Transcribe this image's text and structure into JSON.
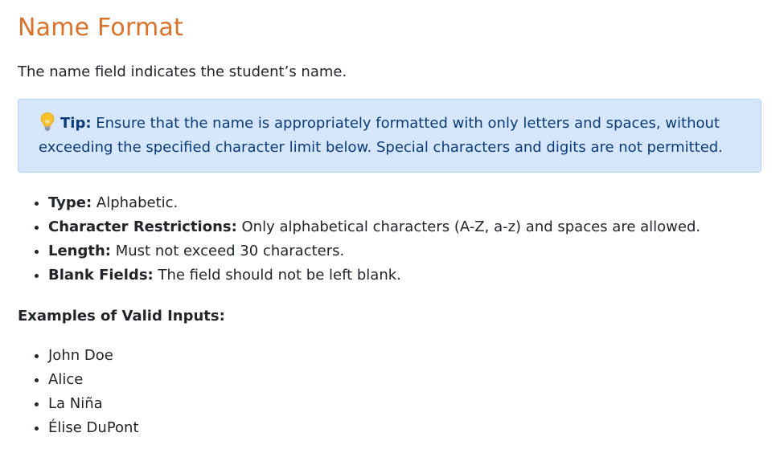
{
  "page": {
    "title": "Name Format",
    "intro": "The name field indicates the student’s name."
  },
  "tip": {
    "icon": "lightbulb-icon",
    "label": "Tip:",
    "text": " Ensure that the name is appropriately formatted with only letters and spaces, without exceeding the specified character limit below. Special characters and digits are not permitted."
  },
  "rules": [
    {
      "key": "Type:",
      "value": " Alphabetic."
    },
    {
      "key": "Character Restrictions:",
      "value": " Only alphabetical characters (A-Z, a-z) and spaces are allowed."
    },
    {
      "key": "Length:",
      "value": " Must not exceed 30 characters."
    },
    {
      "key": "Blank Fields:",
      "value": " The field should not be left blank."
    }
  ],
  "examples": {
    "heading": "Examples of Valid Inputs:",
    "items": [
      "John Doe",
      "Alice",
      "La Niña",
      "Élise DuPont"
    ]
  },
  "colors": {
    "title": "#d9732b",
    "tip_background": "#d6e7fd",
    "tip_text": "#0b3c7a"
  }
}
